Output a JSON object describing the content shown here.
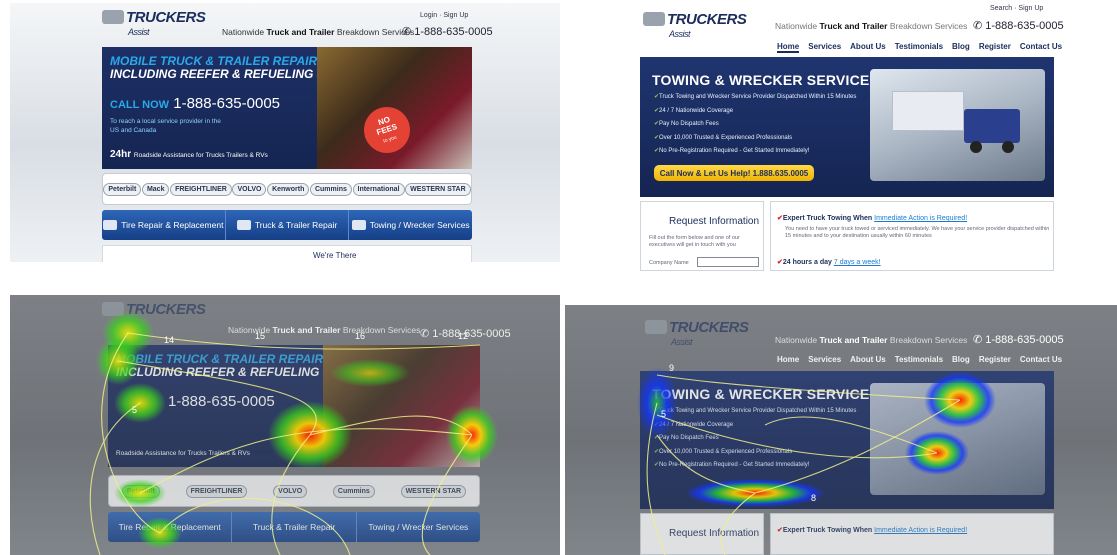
{
  "site": {
    "logo_main": "TRUCKERS",
    "logo_sub": "Assist",
    "tagline_pre": "Nationwide",
    "tagline_bold": "Truck and Trailer",
    "tagline_post": "Breakdown Services",
    "phone": "1-888-635-0005",
    "login": "Login",
    "signup": "Sign Up",
    "search": "Search"
  },
  "variant_a": {
    "headline_1": "MOBILE TRUCK & TRAILER REPAIR",
    "headline_2": "INCLUDING REEFER & REFUELING SERVICES",
    "call_label": "CALL NOW",
    "call_number": "1-888-635-0005",
    "reach_text": "To reach a local service provider in the US and Canada",
    "hours_big": "24hr",
    "hours_text": "Roadside Assistance for Trucks Trailers & RVs",
    "badge_line1": "NO",
    "badge_line2": "FEES",
    "badge_line3": "to you",
    "brands": [
      "Peterbilt",
      "Mack",
      "FREIGHTLINER",
      "VOLVO",
      "Kenworth",
      "Cummins",
      "International",
      "WESTERN STAR"
    ],
    "services": [
      "Tire Repair & Replacement",
      "Truck & Trailer Repair",
      "Towing / Wrecker Services"
    ],
    "footer_peek": "We're There"
  },
  "variant_b": {
    "nav": [
      {
        "label": "Home",
        "active": true
      },
      {
        "label": "Services",
        "active": false
      },
      {
        "label": "About Us",
        "active": false
      },
      {
        "label": "Testimonials",
        "active": false
      },
      {
        "label": "Blog",
        "active": false
      },
      {
        "label": "Register",
        "active": false
      },
      {
        "label": "Contact Us",
        "active": false
      }
    ],
    "headline": "TOWING & WRECKER SERVICE",
    "bullets": [
      "Truck Towing and Wrecker Service Provider Dispatched Within 15 Minutes",
      "24 / 7 Nationwide Coverage",
      "Pay No Dispatch Fees",
      "Over 10,000 Trusted & Experienced Professionals",
      "No Pre-Registration Required - Get Started Immediately!"
    ],
    "cta": "Call Now & Let Us Help! 1.888.635.0005",
    "form_title": "Request Information",
    "form_help": "Fill out the form below and one of our executives will get in touch with you",
    "form_company_label": "Company Name",
    "check1_bold": "Expert Truck Towing When",
    "check1_link": "Immediate Action is Required!",
    "check1_text": "You need to have your truck towed or serviced immediately. We have your service provider dispatched within 15 minutes and to your destination usually within 60 minutes",
    "check2_bold": "24 hours a day",
    "check2_link": "7 days a week!"
  },
  "heatmap_a_fixations": [
    "14",
    "15",
    "16",
    "12",
    "5"
  ],
  "heatmap_b_fixations": [
    "9",
    "5",
    "8"
  ]
}
